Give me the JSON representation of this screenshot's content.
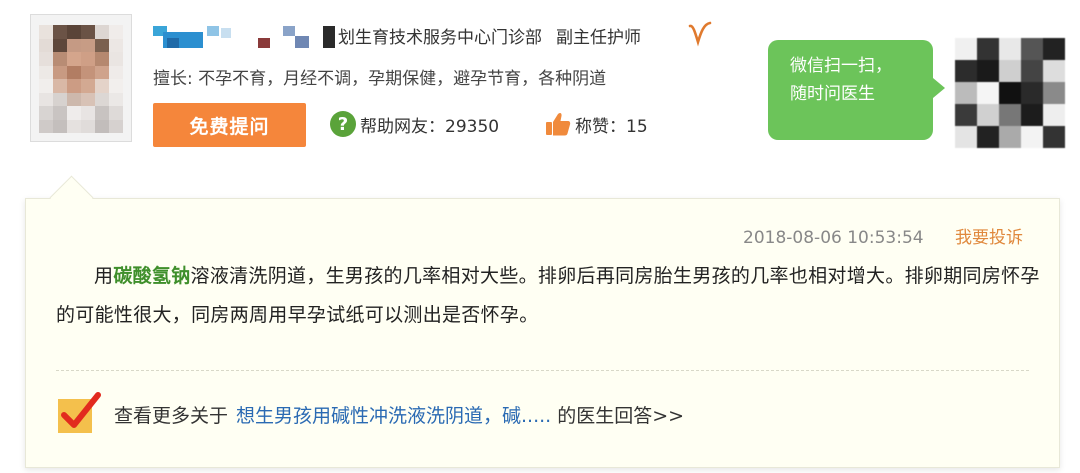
{
  "doctor": {
    "department_title": "划生育技术服务中心门诊部",
    "job_title": "副主任护师",
    "specialty": "擅长: 不孕不育，月经不调，孕期保健，避孕节育，各种阴道",
    "ask_button_label": "免费提问",
    "help_icon_glyph": "?",
    "help_label": "帮助网友：29350",
    "praise_label": "称赞：15"
  },
  "wechat": {
    "line1": "微信扫一扫，",
    "line2": "随时问医生"
  },
  "answer": {
    "timestamp": "2018-08-06 10:53:54",
    "report_label": "我要投诉",
    "text_prefix": "用",
    "keyword": "碳酸氢钠",
    "text_body": "溶液清洗阴道，生男孩的几率相对大些。排卵后再同房胎生男孩的几率也相对增大。排卵期同房怀孕的可能性很大，同房两周用早孕试纸可以测出是否怀孕。"
  },
  "more": {
    "prefix": "查看更多关于",
    "link_text": "想生男孩用碱性冲洗液洗阴道，碱.....",
    "suffix": "的医生回答>>"
  },
  "colors": {
    "accent_orange": "#f5863b",
    "wechat_green": "#6cc45a",
    "keyword_green": "#3f8f2b",
    "link_blue": "#2a6ab3",
    "card_background": "#fffff3"
  },
  "icons": [
    "avatar",
    "verified-v-icon",
    "help-question-icon",
    "thumbs-up-icon",
    "qr-code",
    "check-mark-icon"
  ]
}
